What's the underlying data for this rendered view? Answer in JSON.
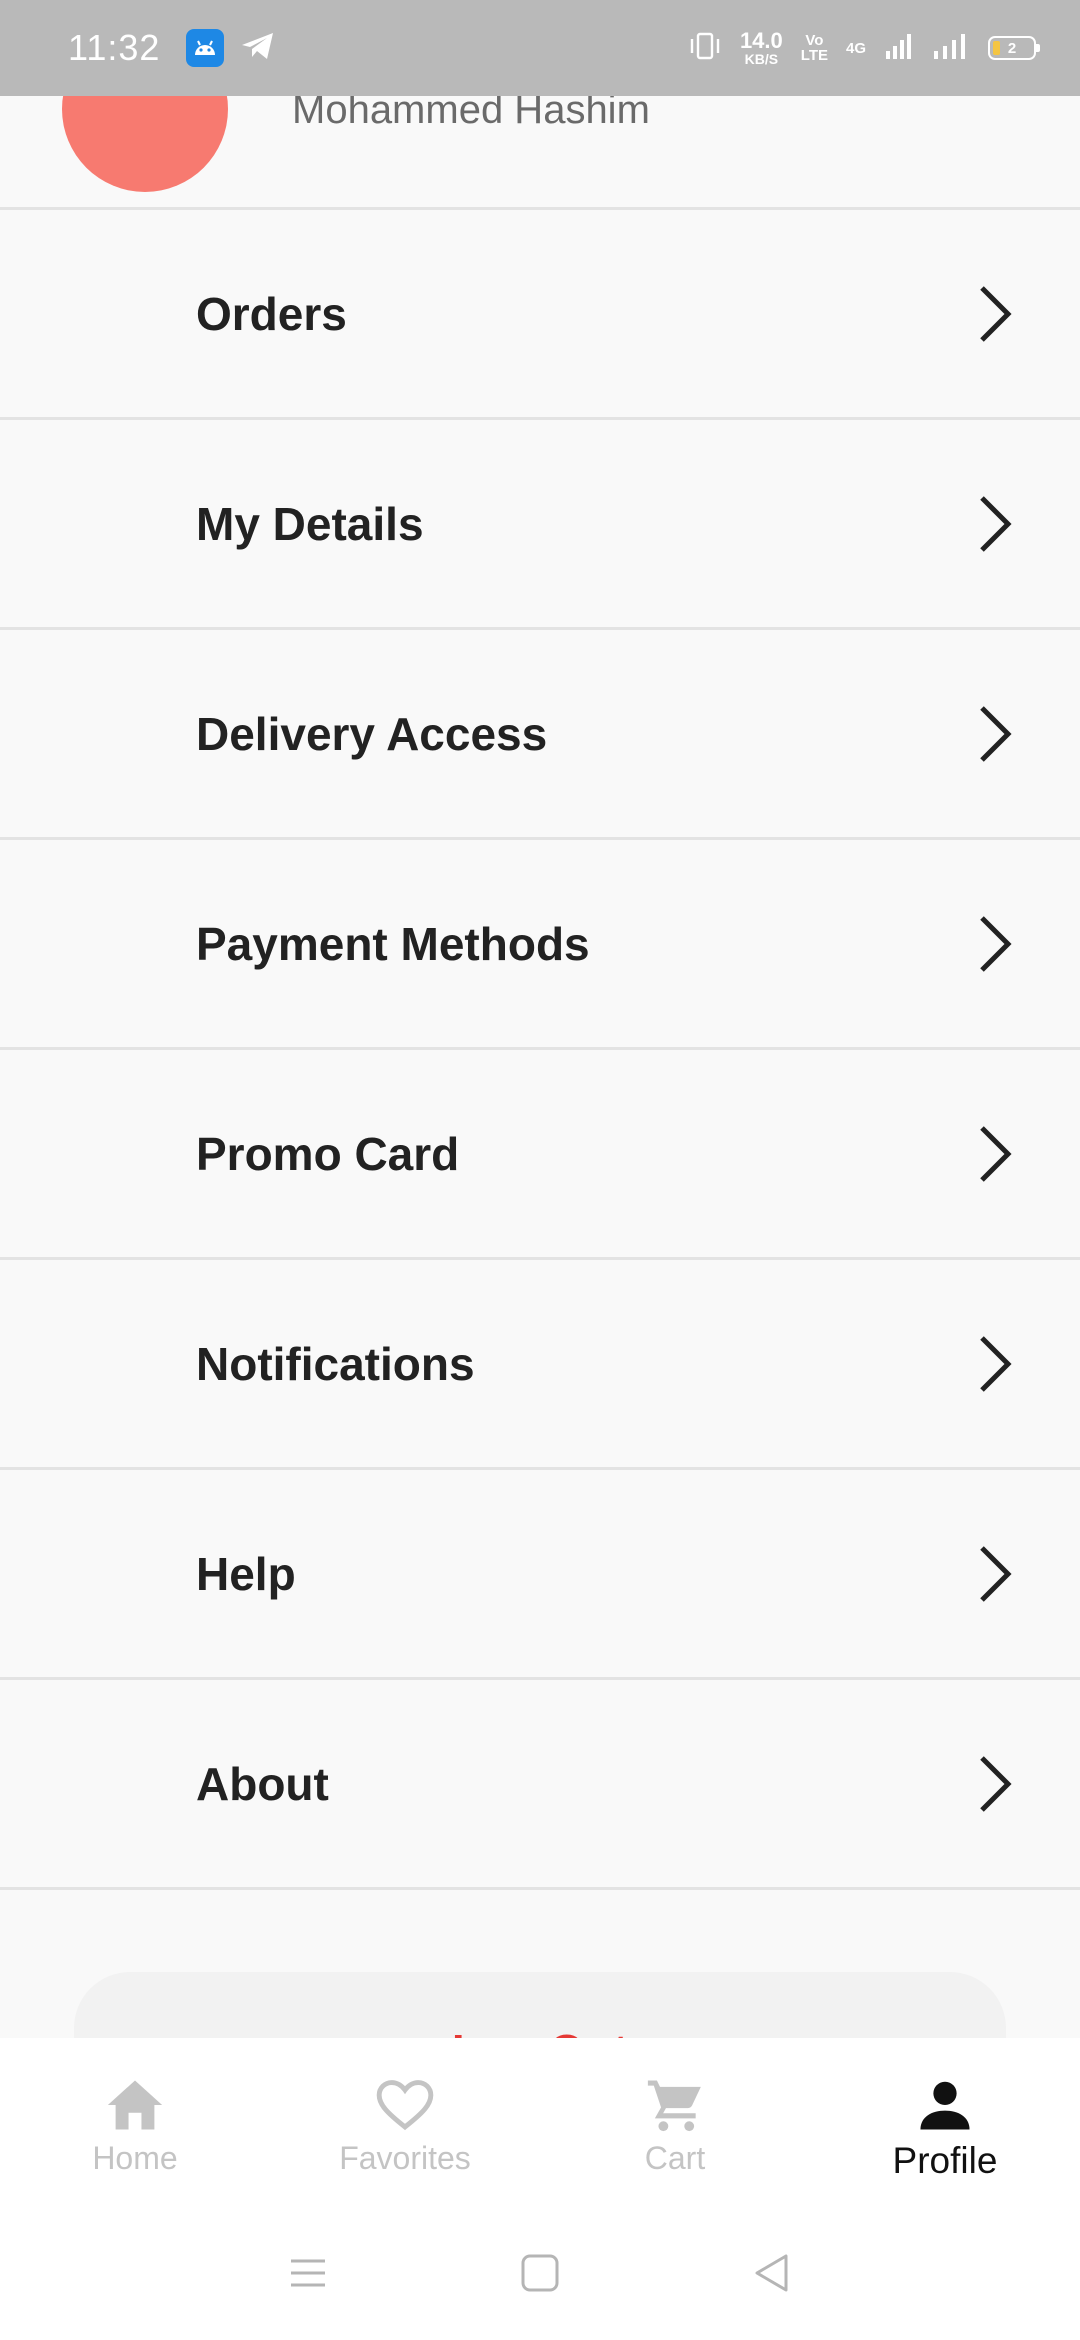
{
  "status_bar": {
    "time": "11:32",
    "net_speed_value": "14.0",
    "net_speed_unit": "KB/S",
    "volte_top": "Vo",
    "volte_bottom": "LTE",
    "network_type": "4G",
    "battery_level": "2"
  },
  "profile": {
    "name": "Mohammed Hashim",
    "avatar_color": "#f77a70"
  },
  "menu": {
    "items": [
      {
        "label": "Orders"
      },
      {
        "label": "My Details"
      },
      {
        "label": "Delivery Access"
      },
      {
        "label": "Payment Methods"
      },
      {
        "label": "Promo Card"
      },
      {
        "label": "Notifications"
      },
      {
        "label": "Help"
      },
      {
        "label": "About"
      }
    ]
  },
  "logout": {
    "label": "Log Out",
    "color": "#e53935"
  },
  "bottom_nav": {
    "items": [
      {
        "label": "Home",
        "icon": "home-icon",
        "active": false
      },
      {
        "label": "Favorites",
        "icon": "heart-icon",
        "active": false
      },
      {
        "label": "Cart",
        "icon": "cart-icon",
        "active": false
      },
      {
        "label": "Profile",
        "icon": "person-icon",
        "active": true
      }
    ]
  },
  "system_nav": {
    "icons": [
      "menu-icon",
      "home-square-icon",
      "back-icon"
    ]
  }
}
